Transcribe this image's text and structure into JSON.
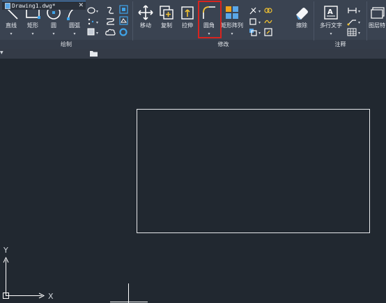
{
  "ribbon": {
    "panels": {
      "draw": "绘制",
      "modify": "修改",
      "annotate": "注释"
    },
    "draw": {
      "line": "直线",
      "rectangle": "矩形",
      "circle": "圆",
      "arc": "圆弧"
    },
    "modify": {
      "move": "移动",
      "copy": "复制",
      "stretch": "拉伸",
      "fillet": "圆角",
      "rect_array": "矩形阵列",
      "erase": "擦除"
    },
    "annotate": {
      "mtext": "多行文字"
    },
    "layer_props": "图层特"
  },
  "tabs": [
    {
      "label": "Drawing1.dwg*",
      "close": "✕"
    }
  ],
  "ucs": {
    "x": "X",
    "y": "Y"
  },
  "colors": {
    "canvas": "#212830",
    "ribbon": "#3a4351",
    "highlight": "#d8241f",
    "accent": "#4a8fd6"
  }
}
